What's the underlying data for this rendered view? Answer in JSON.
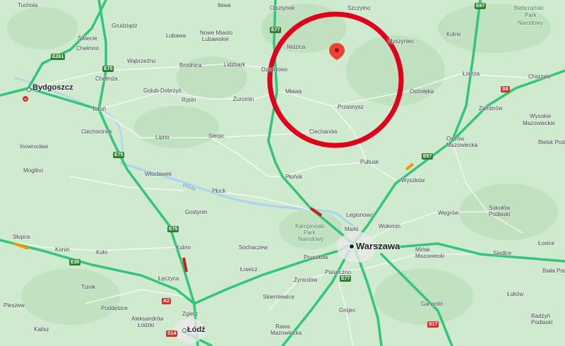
{
  "map": {
    "colors": {
      "land": "#cfeacf",
      "highway": "#34c47c",
      "traffic_red": "#c5221f",
      "traffic_orange": "#f29900",
      "water": "#a8d4f0",
      "marker": "#ea4335",
      "circle": "#e0001b"
    },
    "cities_major": [
      {
        "name": "Bydgoszcz",
        "id": "bydgoszcz"
      },
      {
        "name": "Warszawa",
        "id": "warszawa"
      },
      {
        "name": "Łódź",
        "id": "lodz"
      }
    ],
    "towns": {
      "tuchola": "Tuchola",
      "ilawa": "Iława",
      "olsztynek": "Olsztynek",
      "szczytno": "Szczytno",
      "biebrzanski": "Biebrzański",
      "park_narodowy_1": "Park",
      "narodowy_1": "Narodowy",
      "grudziadz": "Grudziądz",
      "swiecie": "Świecie",
      "chelmno": "Chełmno",
      "nowe_miasto": "Nowe Miasto",
      "lubawskie": "Lubawskie",
      "lubawa": "Lubawa",
      "nidzica": "Nidzica",
      "myszyniec": "Myszyniec",
      "kolno": "Kolno",
      "wabrzezno": "Wąbrzeźno",
      "brodnica": "Brodnica",
      "lidzbark": "Lidzbark",
      "dzialdowo": "Działdowo",
      "lomza": "Łomża",
      "chorzele": "Chorzele",
      "chelmza": "Chełmża",
      "golub": "Golub-Dobrzyń",
      "rypin": "Rypin",
      "zuromin": "Żuromin",
      "mlawa": "Mława",
      "ostroleka": "Ostrołęka",
      "zambrow": "Zambrów",
      "torun": "Toruń",
      "przasnysz": "Przasnysz",
      "wysokie": "Wysokie",
      "mazowieckie": "Mazowieckie",
      "ciechocinek": "Ciechocinek",
      "lipno": "Lipno",
      "sierpc": "Sierpc",
      "ciechanow": "Ciechanów",
      "ostrow": "Ostrów",
      "ostrow2": "Mazowiecka",
      "bielsk": "Bielsk Pod",
      "inowroclaw": "Inowrocław",
      "pultusk": "Pułtusk",
      "mogilno": "Mogilno",
      "wloclawek": "Włocławek",
      "plonsk": "Płońsk",
      "wyszkow": "Wyszków",
      "plock": "Płock",
      "wisla": "Wisła",
      "legionowo": "Legionowo",
      "wegrow": "Węgrów",
      "gostynin": "Gostynin",
      "kampinoski": "Kampinoski",
      "park": "Park",
      "narodowy": "Narodowy",
      "sokolow": "Sokołów",
      "podlaski": "Podlaski",
      "slupca": "Słupca",
      "marki": "Marki",
      "wolomin": "Wołomin",
      "konin": "Konin",
      "kolo": "Koło",
      "kutno": "Kutno",
      "sochaczew": "Sochaczew",
      "minsk": "Mińsk",
      "minsk2": "Mazowiecki",
      "siedlce": "Siedlce",
      "losice": "Łosice",
      "pruszkow": "Pruszków",
      "leczyca": "Łęczyca",
      "lowicz": "Łowicz",
      "zyrardow": "Żyrardów",
      "piaseczno": "Piaseczno",
      "biala": "Biała Pod",
      "turek": "Turek",
      "skierniewice": "Skierniewice",
      "lukow": "Łuków",
      "pleszew": "Pleszew",
      "poddebice": "Poddębice",
      "aleksandrow": "Aleksandrów",
      "lodzki": "Łódzki",
      "zgierz": "Zgierz",
      "garwolin": "Garwolin",
      "radzyn": "Radzyń",
      "podlaski2": "Podlaski",
      "grojec": "Grójec",
      "kalisz": "Kalisz",
      "rawa": "Rawa",
      "mazowiecka": "Mazowiecka"
    },
    "road_shields": [
      {
        "id": "e261",
        "label": "E261",
        "kind": "green"
      },
      {
        "id": "e75a",
        "label": "E75",
        "kind": "green"
      },
      {
        "id": "e77a",
        "label": "E77",
        "kind": "green"
      },
      {
        "id": "e67a",
        "label": "E67",
        "kind": "green"
      },
      {
        "id": "e75b",
        "label": "E75",
        "kind": "green"
      },
      {
        "id": "e67b",
        "label": "E67",
        "kind": "green"
      },
      {
        "id": "e75c",
        "label": "E75",
        "kind": "green"
      },
      {
        "id": "e30",
        "label": "E30",
        "kind": "green"
      },
      {
        "id": "e77b",
        "label": "E77",
        "kind": "green"
      },
      {
        "id": "s8",
        "label": "S8",
        "kind": "red"
      },
      {
        "id": "a2",
        "label": "A2",
        "kind": "red"
      },
      {
        "id": "s14",
        "label": "S14",
        "kind": "red"
      },
      {
        "id": "s17",
        "label": "S17",
        "kind": "red"
      }
    ],
    "pin_icon": "map-pin-icon",
    "no_entry_icon": "no-entry-icon"
  }
}
